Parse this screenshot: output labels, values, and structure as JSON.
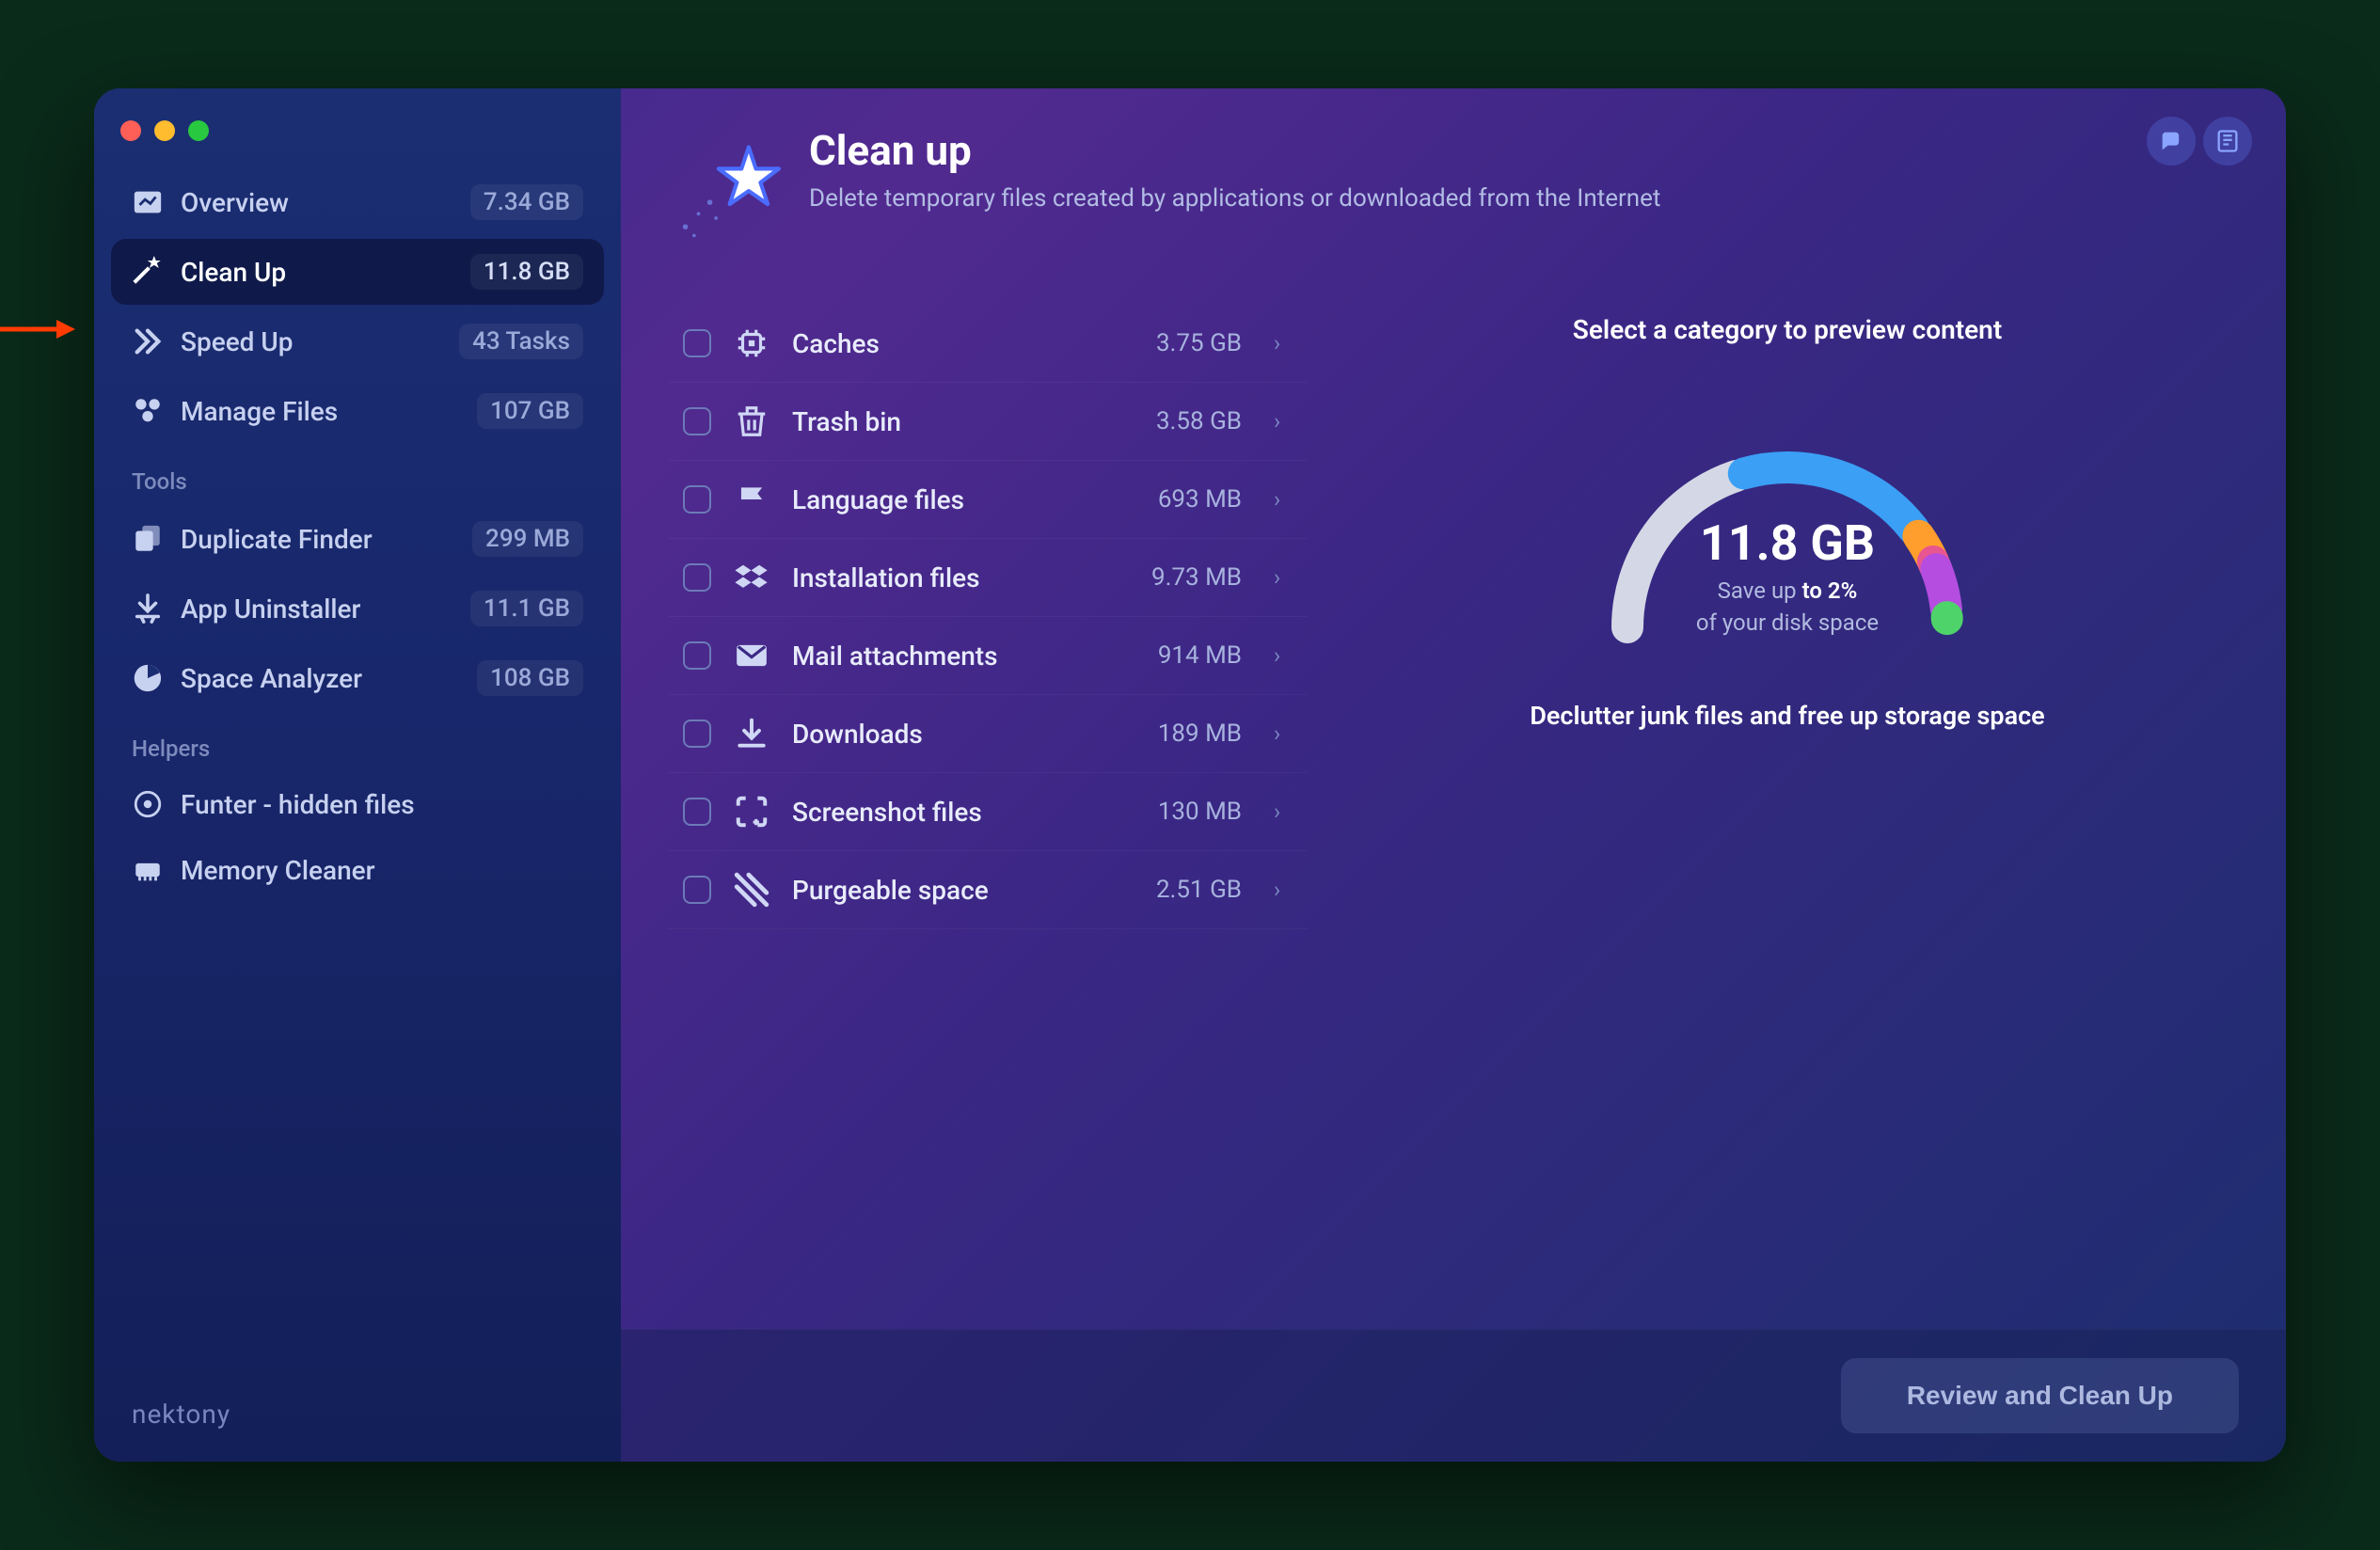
{
  "header": {
    "title": "Clean up",
    "subtitle": "Delete temporary files created by applications or downloaded from the Internet"
  },
  "sidebar": {
    "brand": "nektony",
    "main_items": [
      {
        "label": "Overview",
        "value": "7.34 GB",
        "icon": "overview-icon",
        "active": false
      },
      {
        "label": "Clean Up",
        "value": "11.8 GB",
        "icon": "cleanup-icon",
        "active": true
      },
      {
        "label": "Speed Up",
        "value": "43 Tasks",
        "icon": "speedup-icon",
        "active": false
      },
      {
        "label": "Manage Files",
        "value": "107 GB",
        "icon": "managefiles-icon",
        "active": false
      }
    ],
    "tools_label": "Tools",
    "tools_items": [
      {
        "label": "Duplicate Finder",
        "value": "299 MB",
        "icon": "duplicate-icon"
      },
      {
        "label": "App Uninstaller",
        "value": "11.1 GB",
        "icon": "uninstaller-icon"
      },
      {
        "label": "Space Analyzer",
        "value": "108 GB",
        "icon": "analyzer-icon"
      }
    ],
    "helpers_label": "Helpers",
    "helpers_items": [
      {
        "label": "Funter - hidden files",
        "value": "",
        "icon": "funter-icon"
      },
      {
        "label": "Memory Cleaner",
        "value": "",
        "icon": "memory-icon"
      }
    ]
  },
  "categories": [
    {
      "name": "Caches",
      "size": "3.75 GB",
      "icon": "chip-icon"
    },
    {
      "name": "Trash bin",
      "size": "3.58 GB",
      "icon": "trash-icon"
    },
    {
      "name": "Language files",
      "size": "693 MB",
      "icon": "flag-icon"
    },
    {
      "name": "Installation files",
      "size": "9.73 MB",
      "icon": "dropbox-icon"
    },
    {
      "name": "Mail attachments",
      "size": "914 MB",
      "icon": "mail-icon"
    },
    {
      "name": "Downloads",
      "size": "189 MB",
      "icon": "download-icon"
    },
    {
      "name": "Screenshot files",
      "size": "130 MB",
      "icon": "screenshot-icon"
    },
    {
      "name": "Purgeable space",
      "size": "2.51 GB",
      "icon": "purgeable-icon"
    }
  ],
  "preview": {
    "prompt": "Select a category to preview content",
    "big_value": "11.8 GB",
    "save_text_1": "Save up ",
    "save_text_2": "to 2%",
    "save_text_3": "of your disk space",
    "subtitle": "Declutter junk files and free up storage space"
  },
  "footer": {
    "button_label": "Review and Clean Up"
  },
  "chart_data": {
    "type": "pie",
    "title": "Clean up total 11.8 GB",
    "categories": [
      "Caches",
      "Trash bin",
      "Language files",
      "Installation files",
      "Mail attachments",
      "Downloads",
      "Screenshot files",
      "Purgeable space"
    ],
    "values_mb": [
      3840,
      3666,
      693,
      9.73,
      914,
      189,
      130,
      2570
    ],
    "colors": [
      "#d4d8e6",
      "#3a9ff5",
      "#ff9e2c",
      "#e8568f",
      "#b44de0",
      "#4ed36a",
      "#ffffff",
      "#ffffff"
    ]
  }
}
